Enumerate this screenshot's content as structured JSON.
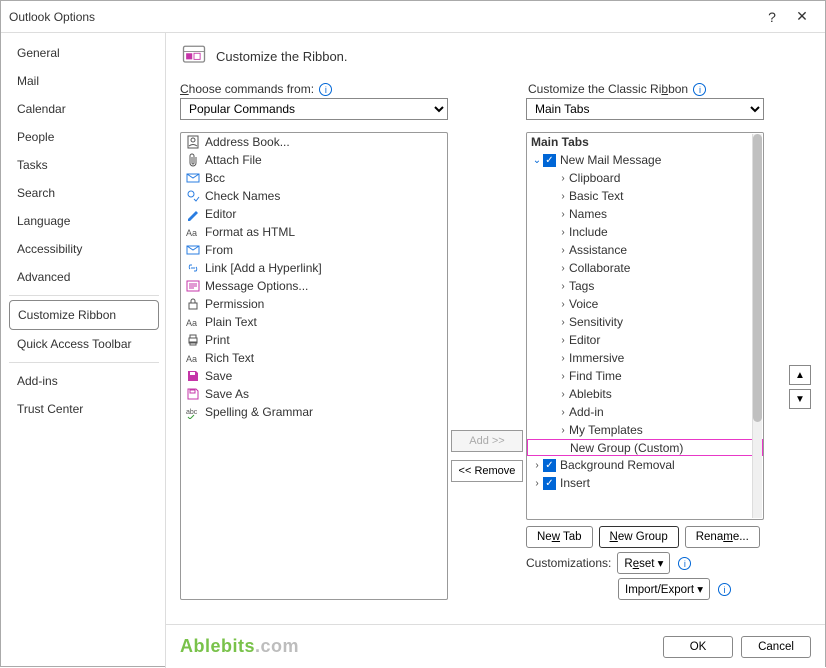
{
  "titlebar": {
    "title": "Outlook Options"
  },
  "sidebar": {
    "items": [
      {
        "label": "General"
      },
      {
        "label": "Mail"
      },
      {
        "label": "Calendar"
      },
      {
        "label": "People"
      },
      {
        "label": "Tasks"
      },
      {
        "label": "Search"
      },
      {
        "label": "Language"
      },
      {
        "label": "Accessibility"
      },
      {
        "label": "Advanced"
      },
      {
        "label": "Customize Ribbon",
        "selected": true
      },
      {
        "label": "Quick Access Toolbar"
      },
      {
        "label": "Add-ins"
      },
      {
        "label": "Trust Center"
      }
    ]
  },
  "heading": "Customize the Ribbon.",
  "left_label": "Choose commands from:",
  "right_label": "Customize the Classic Ribbon",
  "left_select": "Popular Commands",
  "right_select": "Main Tabs",
  "commands": [
    "Address Book...",
    "Attach File",
    "Bcc",
    "Check Names",
    "Editor",
    "Format as HTML",
    "From",
    "Link [Add a Hyperlink]",
    "Message Options...",
    "Permission",
    "Plain Text",
    "Print",
    "Rich Text",
    "Save",
    "Save As",
    "Spelling & Grammar"
  ],
  "mid": {
    "add": "Add >>",
    "remove": "<< Remove"
  },
  "tree": {
    "header": "Main Tabs",
    "root_label": "New Mail Message",
    "children": [
      "Clipboard",
      "Basic Text",
      "Names",
      "Include",
      "Assistance",
      "Collaborate",
      "Tags",
      "Voice",
      "Sensitivity",
      "Editor",
      "Immersive",
      "Find Time",
      "Ablebits",
      "Add-in",
      "My Templates"
    ],
    "new_group": "New Group (Custom)",
    "bg_removal": "Background Removal",
    "insert": "Insert"
  },
  "buttons": {
    "new_tab": "New Tab",
    "new_group": "New Group",
    "rename": "Rename...",
    "customizations": "Customizations:",
    "reset": "Reset",
    "import_export": "Import/Export"
  },
  "footer": {
    "ok": "OK",
    "cancel": "Cancel"
  },
  "brand": {
    "a": "Ablebits",
    "b": ".com"
  }
}
